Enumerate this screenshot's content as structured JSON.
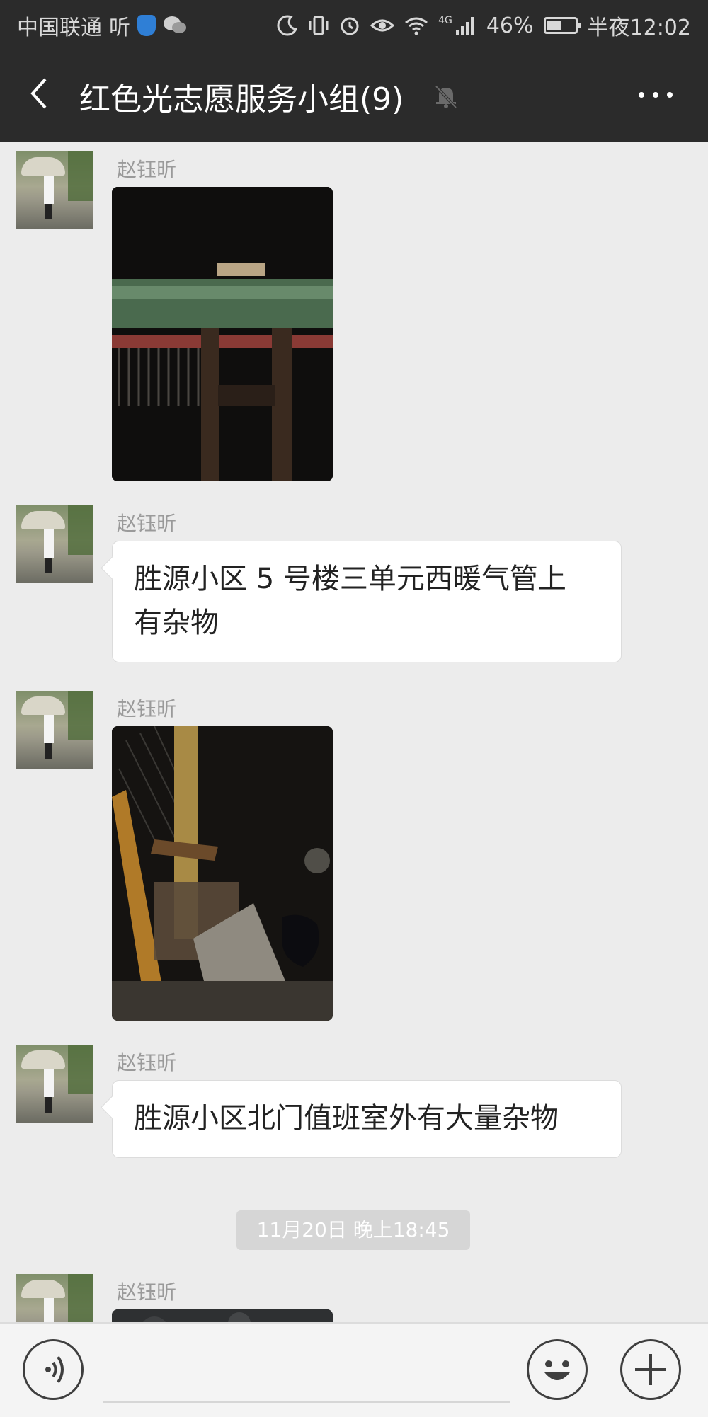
{
  "status_bar": {
    "carrier": "中国联通",
    "carrier_app": "听",
    "network": "4G",
    "battery_percent": "46%",
    "time": "半夜12:02"
  },
  "header": {
    "title": "红色光志愿服务小组(9)"
  },
  "messages": [
    {
      "sender": "赵钰昕",
      "type": "image"
    },
    {
      "sender": "赵钰昕",
      "type": "text",
      "line1": "胜源小区 5 号楼三单元西暖气管上",
      "line2": "有杂物"
    },
    {
      "sender": "赵钰昕",
      "type": "image"
    },
    {
      "sender": "赵钰昕",
      "type": "text",
      "text": "胜源小区北门值班室外有大量杂物"
    },
    {
      "sender": "赵钰昕",
      "type": "image"
    }
  ],
  "timestamp_divider": "11月20日 晚上18:45",
  "colors": {
    "header_bg": "#2b2b2b",
    "chat_bg": "#ececec",
    "bubble_bg": "#ffffff",
    "sender_text": "#9a9a9a"
  }
}
